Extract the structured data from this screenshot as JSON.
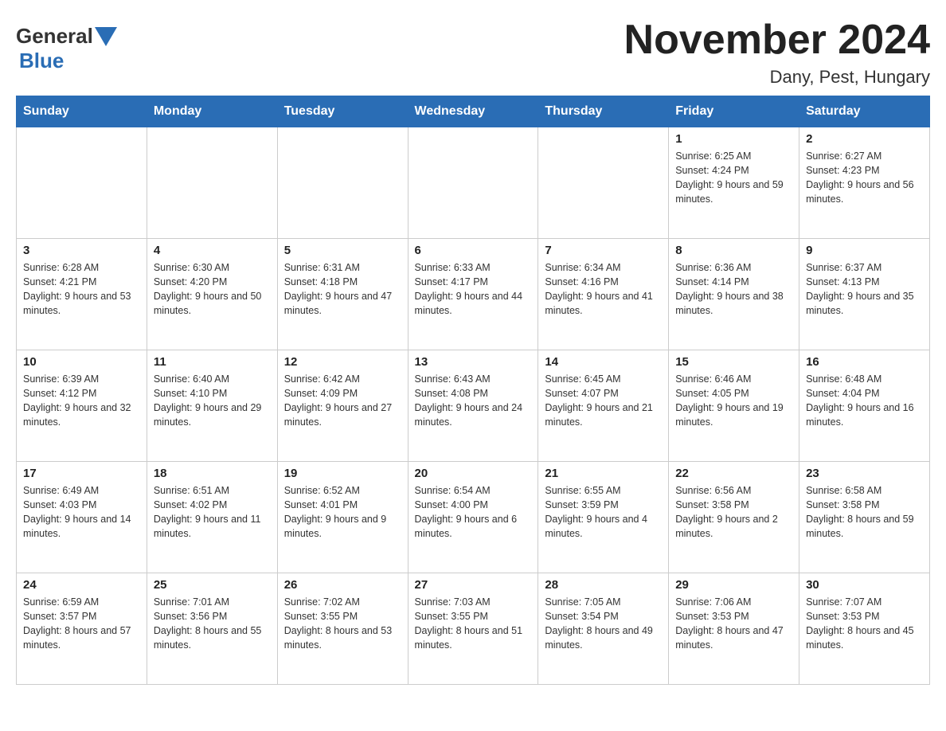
{
  "header": {
    "logo_general": "General",
    "logo_blue": "Blue",
    "title": "November 2024",
    "subtitle": "Dany, Pest, Hungary"
  },
  "weekdays": [
    "Sunday",
    "Monday",
    "Tuesday",
    "Wednesday",
    "Thursday",
    "Friday",
    "Saturday"
  ],
  "weeks": [
    [
      {
        "day": "",
        "info": ""
      },
      {
        "day": "",
        "info": ""
      },
      {
        "day": "",
        "info": ""
      },
      {
        "day": "",
        "info": ""
      },
      {
        "day": "",
        "info": ""
      },
      {
        "day": "1",
        "info": "Sunrise: 6:25 AM\nSunset: 4:24 PM\nDaylight: 9 hours and 59 minutes."
      },
      {
        "day": "2",
        "info": "Sunrise: 6:27 AM\nSunset: 4:23 PM\nDaylight: 9 hours and 56 minutes."
      }
    ],
    [
      {
        "day": "3",
        "info": "Sunrise: 6:28 AM\nSunset: 4:21 PM\nDaylight: 9 hours and 53 minutes."
      },
      {
        "day": "4",
        "info": "Sunrise: 6:30 AM\nSunset: 4:20 PM\nDaylight: 9 hours and 50 minutes."
      },
      {
        "day": "5",
        "info": "Sunrise: 6:31 AM\nSunset: 4:18 PM\nDaylight: 9 hours and 47 minutes."
      },
      {
        "day": "6",
        "info": "Sunrise: 6:33 AM\nSunset: 4:17 PM\nDaylight: 9 hours and 44 minutes."
      },
      {
        "day": "7",
        "info": "Sunrise: 6:34 AM\nSunset: 4:16 PM\nDaylight: 9 hours and 41 minutes."
      },
      {
        "day": "8",
        "info": "Sunrise: 6:36 AM\nSunset: 4:14 PM\nDaylight: 9 hours and 38 minutes."
      },
      {
        "day": "9",
        "info": "Sunrise: 6:37 AM\nSunset: 4:13 PM\nDaylight: 9 hours and 35 minutes."
      }
    ],
    [
      {
        "day": "10",
        "info": "Sunrise: 6:39 AM\nSunset: 4:12 PM\nDaylight: 9 hours and 32 minutes."
      },
      {
        "day": "11",
        "info": "Sunrise: 6:40 AM\nSunset: 4:10 PM\nDaylight: 9 hours and 29 minutes."
      },
      {
        "day": "12",
        "info": "Sunrise: 6:42 AM\nSunset: 4:09 PM\nDaylight: 9 hours and 27 minutes."
      },
      {
        "day": "13",
        "info": "Sunrise: 6:43 AM\nSunset: 4:08 PM\nDaylight: 9 hours and 24 minutes."
      },
      {
        "day": "14",
        "info": "Sunrise: 6:45 AM\nSunset: 4:07 PM\nDaylight: 9 hours and 21 minutes."
      },
      {
        "day": "15",
        "info": "Sunrise: 6:46 AM\nSunset: 4:05 PM\nDaylight: 9 hours and 19 minutes."
      },
      {
        "day": "16",
        "info": "Sunrise: 6:48 AM\nSunset: 4:04 PM\nDaylight: 9 hours and 16 minutes."
      }
    ],
    [
      {
        "day": "17",
        "info": "Sunrise: 6:49 AM\nSunset: 4:03 PM\nDaylight: 9 hours and 14 minutes."
      },
      {
        "day": "18",
        "info": "Sunrise: 6:51 AM\nSunset: 4:02 PM\nDaylight: 9 hours and 11 minutes."
      },
      {
        "day": "19",
        "info": "Sunrise: 6:52 AM\nSunset: 4:01 PM\nDaylight: 9 hours and 9 minutes."
      },
      {
        "day": "20",
        "info": "Sunrise: 6:54 AM\nSunset: 4:00 PM\nDaylight: 9 hours and 6 minutes."
      },
      {
        "day": "21",
        "info": "Sunrise: 6:55 AM\nSunset: 3:59 PM\nDaylight: 9 hours and 4 minutes."
      },
      {
        "day": "22",
        "info": "Sunrise: 6:56 AM\nSunset: 3:58 PM\nDaylight: 9 hours and 2 minutes."
      },
      {
        "day": "23",
        "info": "Sunrise: 6:58 AM\nSunset: 3:58 PM\nDaylight: 8 hours and 59 minutes."
      }
    ],
    [
      {
        "day": "24",
        "info": "Sunrise: 6:59 AM\nSunset: 3:57 PM\nDaylight: 8 hours and 57 minutes."
      },
      {
        "day": "25",
        "info": "Sunrise: 7:01 AM\nSunset: 3:56 PM\nDaylight: 8 hours and 55 minutes."
      },
      {
        "day": "26",
        "info": "Sunrise: 7:02 AM\nSunset: 3:55 PM\nDaylight: 8 hours and 53 minutes."
      },
      {
        "day": "27",
        "info": "Sunrise: 7:03 AM\nSunset: 3:55 PM\nDaylight: 8 hours and 51 minutes."
      },
      {
        "day": "28",
        "info": "Sunrise: 7:05 AM\nSunset: 3:54 PM\nDaylight: 8 hours and 49 minutes."
      },
      {
        "day": "29",
        "info": "Sunrise: 7:06 AM\nSunset: 3:53 PM\nDaylight: 8 hours and 47 minutes."
      },
      {
        "day": "30",
        "info": "Sunrise: 7:07 AM\nSunset: 3:53 PM\nDaylight: 8 hours and 45 minutes."
      }
    ]
  ]
}
